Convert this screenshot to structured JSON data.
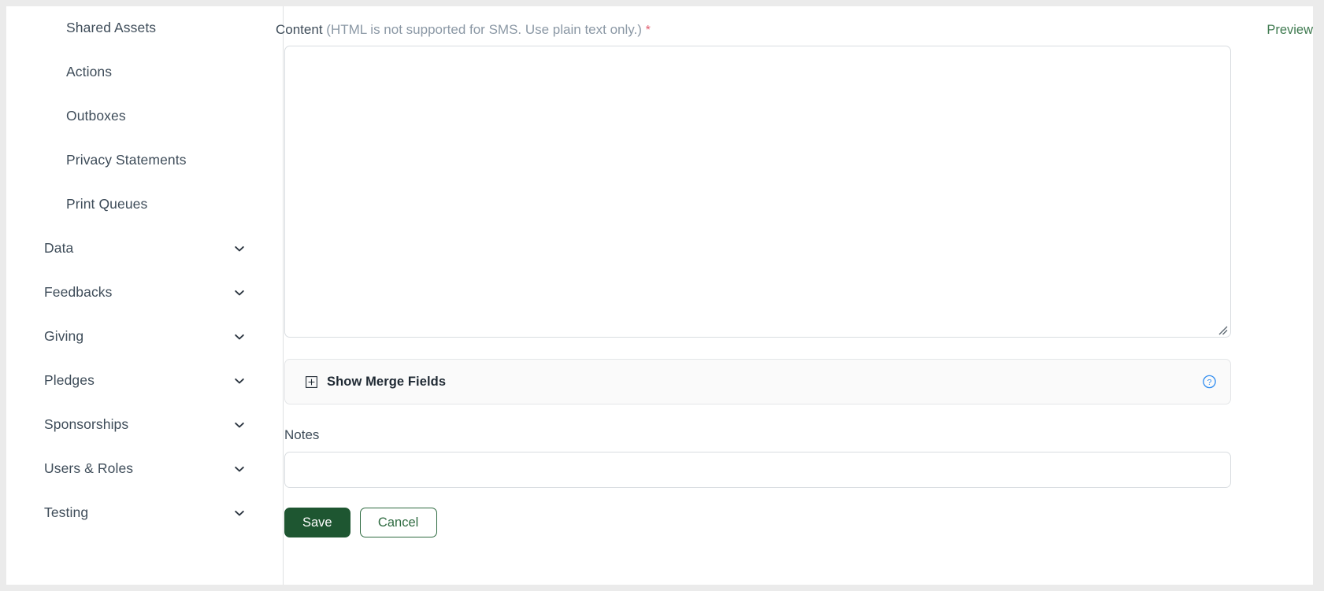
{
  "theme": {
    "page_background": "#ebebeb",
    "card_background": "#ffffff",
    "accent_green": "#1e5631",
    "link_green": "#3f7a50",
    "required_red": "#e05c6e",
    "help_blue": "#2f8cf0",
    "text_primary": "#3e4c59",
    "text_muted": "#8b98a5",
    "border": "#d9dde1"
  },
  "sidebar": {
    "items": [
      {
        "label": "Shared Assets",
        "level": "sub",
        "expandable": false
      },
      {
        "label": "Actions",
        "level": "sub",
        "expandable": false
      },
      {
        "label": "Outboxes",
        "level": "sub",
        "expandable": false
      },
      {
        "label": "Privacy Statements",
        "level": "sub",
        "expandable": false
      },
      {
        "label": "Print Queues",
        "level": "sub",
        "expandable": false
      },
      {
        "label": "Data",
        "level": "top",
        "expandable": true
      },
      {
        "label": "Feedbacks",
        "level": "top",
        "expandable": true
      },
      {
        "label": "Giving",
        "level": "top",
        "expandable": true
      },
      {
        "label": "Pledges",
        "level": "top",
        "expandable": true
      },
      {
        "label": "Sponsorships",
        "level": "top",
        "expandable": true
      },
      {
        "label": "Users & Roles",
        "level": "top",
        "expandable": true
      },
      {
        "label": "Testing",
        "level": "top",
        "expandable": true
      }
    ],
    "chevron_icon": "chevron-down-icon"
  },
  "main": {
    "content_field": {
      "label": "Content",
      "hint": "(HTML is not supported for SMS. Use plain text only.)",
      "required_marker": "*",
      "value": "",
      "placeholder": ""
    },
    "preview_link": {
      "label": "Preview"
    },
    "merge_fields": {
      "label": "Show Merge Fields",
      "toggle_icon": "plus-square-icon",
      "help_icon": "question-circle-icon"
    },
    "notes_field": {
      "label": "Notes",
      "value": "",
      "placeholder": ""
    },
    "actions": {
      "save_label": "Save",
      "cancel_label": "Cancel"
    }
  }
}
